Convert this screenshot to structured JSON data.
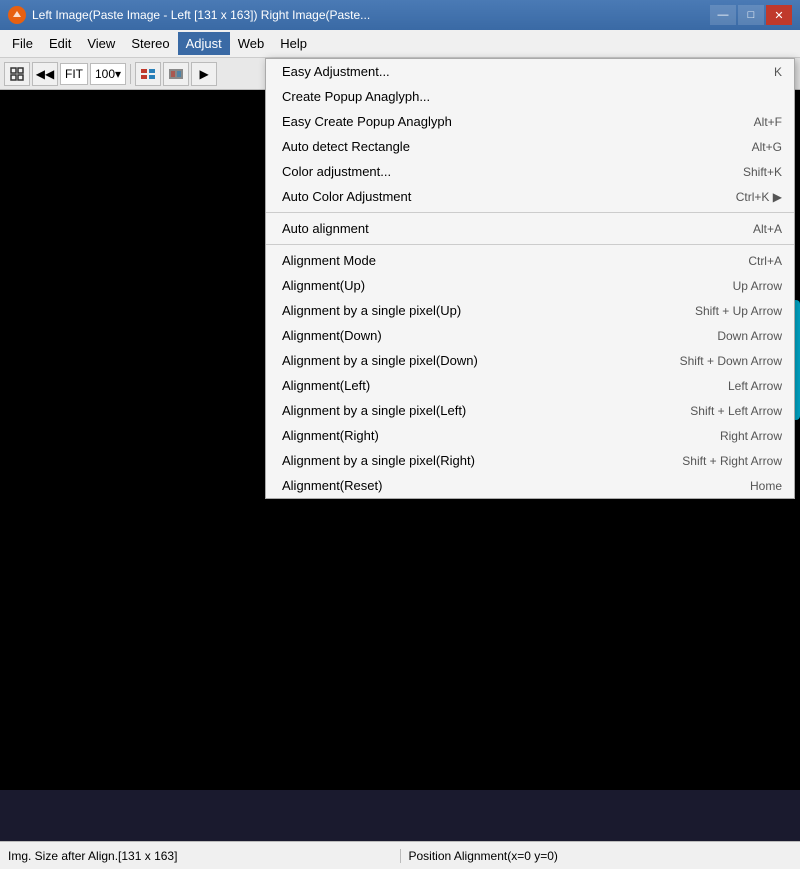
{
  "titleBar": {
    "title": "Left Image(Paste Image - Left [131 x 163]) Right Image(Paste...",
    "controls": {
      "minimize": "—",
      "maximize": "□",
      "close": "✕"
    }
  },
  "menuBar": {
    "items": [
      "File",
      "Edit",
      "View",
      "Stereo",
      "Adjust",
      "Web",
      "Help"
    ],
    "activeIndex": 4
  },
  "toolbar": {
    "fitLabel": "FIT",
    "zoomLabel": "100"
  },
  "dropdown": {
    "items": [
      {
        "label": "Easy Adjustment...",
        "shortcut": "K",
        "separator_after": false
      },
      {
        "label": "Create Popup Anaglyph...",
        "shortcut": "",
        "separator_after": false
      },
      {
        "label": "Easy Create Popup Anaglyph",
        "shortcut": "Alt+F",
        "separator_after": false
      },
      {
        "label": "Auto detect Rectangle",
        "shortcut": "Alt+G",
        "separator_after": false
      },
      {
        "label": "Color adjustment...",
        "shortcut": "Shift+K",
        "separator_after": false
      },
      {
        "label": "Auto Color Adjustment",
        "shortcut": "Ctrl+K ▶",
        "separator_after": true
      },
      {
        "label": "Auto alignment",
        "shortcut": "Alt+A",
        "separator_after": true
      },
      {
        "label": "Alignment Mode",
        "shortcut": "Ctrl+A",
        "separator_after": false
      },
      {
        "label": "Alignment(Up)",
        "shortcut": "Up Arrow",
        "separator_after": false
      },
      {
        "label": "Alignment by a single pixel(Up)",
        "shortcut": "Shift + Up Arrow",
        "separator_after": false
      },
      {
        "label": "Alignment(Down)",
        "shortcut": "Down Arrow",
        "separator_after": false
      },
      {
        "label": "Alignment by a single pixel(Down)",
        "shortcut": "Shift + Down Arrow",
        "separator_after": false
      },
      {
        "label": "Alignment(Left)",
        "shortcut": "Left Arrow",
        "separator_after": false
      },
      {
        "label": "Alignment by a single pixel(Left)",
        "shortcut": "Shift + Left Arrow",
        "separator_after": false
      },
      {
        "label": "Alignment(Right)",
        "shortcut": "Right Arrow",
        "separator_after": false
      },
      {
        "label": "Alignment by a single pixel(Right)",
        "shortcut": "Shift + Right Arrow",
        "separator_after": false
      },
      {
        "label": "Alignment(Reset)",
        "shortcut": "Home",
        "separator_after": false
      }
    ]
  },
  "statusBar": {
    "left": "Img. Size after Align.[131 x 163]",
    "right": "Position Alignment(x=0 y=0)"
  }
}
